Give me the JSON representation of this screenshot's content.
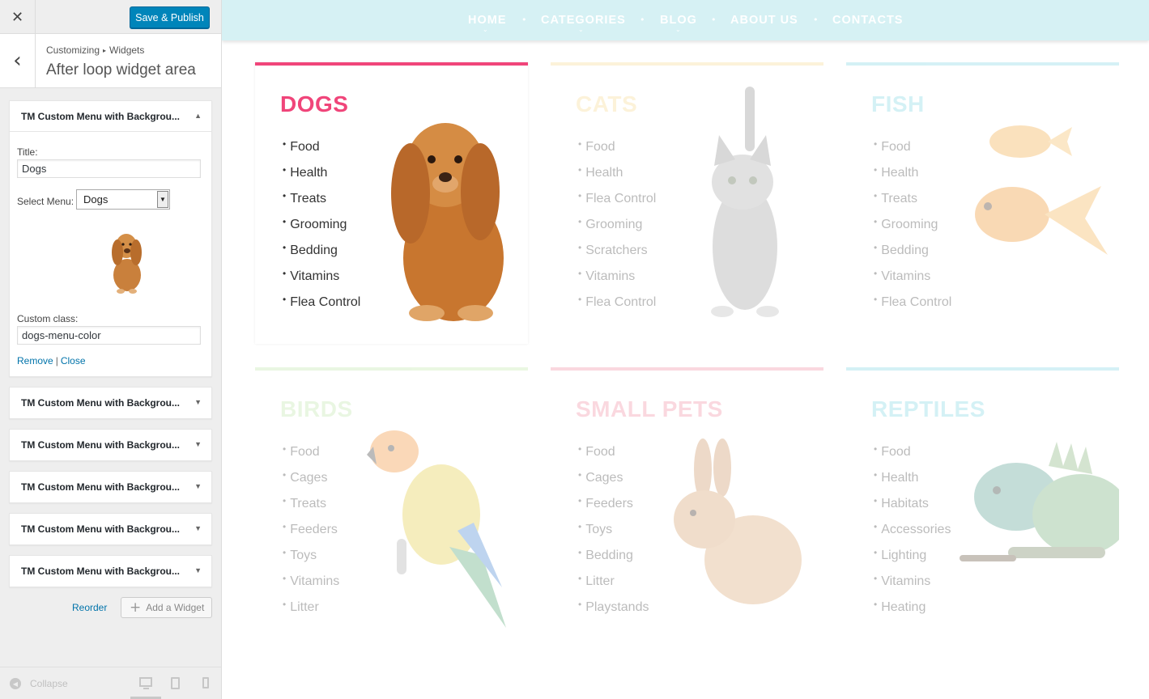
{
  "sidebar": {
    "close_glyph": "✕",
    "save_label": "Save & Publish",
    "back_glyph": "‹",
    "breadcrumb": {
      "root": "Customizing",
      "sep": "▸",
      "child": "Widgets"
    },
    "section_title": "After loop widget area",
    "active_widget": {
      "header": "TM Custom Menu with Backgrou...",
      "arrow": "▲",
      "title_label": "Title:",
      "title_value": "Dogs",
      "select_label": "Select Menu:",
      "select_value": "Dogs",
      "select_arrow": "▼",
      "class_label": "Custom class:",
      "class_value": "dogs-menu-color",
      "remove_label": "Remove",
      "link_sep": "|",
      "close_label": "Close"
    },
    "collapsed_widgets": [
      {
        "header": "TM Custom Menu with Backgrou...",
        "arrow": "▼"
      },
      {
        "header": "TM Custom Menu with Backgrou...",
        "arrow": "▼"
      },
      {
        "header": "TM Custom Menu with Backgrou...",
        "arrow": "▼"
      },
      {
        "header": "TM Custom Menu with Backgrou...",
        "arrow": "▼"
      },
      {
        "header": "TM Custom Menu with Backgrou...",
        "arrow": "▼"
      }
    ],
    "reorder_label": "Reorder",
    "add_widget_plus": "+",
    "add_widget_label": "Add a Widget",
    "collapse_glyph": "◀",
    "collapse_label": "Collapse"
  },
  "nav": {
    "items": [
      "HOME",
      "CATEGORIES",
      "BLOG",
      "ABOUT US",
      "CONTACTS"
    ],
    "dot": "•",
    "caret": "⌄",
    "bg_color": "#d6f1f4"
  },
  "cards": [
    {
      "title": "DOGS",
      "color": "#f0457a",
      "items": [
        "Food",
        "Health",
        "Treats",
        "Grooming",
        "Bedding",
        "Vitamins",
        "Flea Control"
      ]
    },
    {
      "title": "CATS",
      "color": "#f8d98d",
      "items": [
        "Food",
        "Health",
        "Flea Control",
        "Grooming",
        "Scratchers",
        "Vitamins",
        "Flea Control"
      ]
    },
    {
      "title": "FISH",
      "color": "#7fd6e3",
      "items": [
        "Food",
        "Health",
        "Treats",
        "Grooming",
        "Bedding",
        "Vitamins",
        "Flea Control"
      ]
    },
    {
      "title": "BIRDS",
      "color": "#bfe6a8",
      "items": [
        "Food",
        "Cages",
        "Treats",
        "Feeders",
        "Toys",
        "Vitamins",
        "Litter"
      ]
    },
    {
      "title": "SMALL PETS",
      "color": "#f08aa0",
      "items": [
        "Food",
        "Cages",
        "Feeders",
        "Toys",
        "Bedding",
        "Litter",
        "Playstands"
      ]
    },
    {
      "title": "REPTILES",
      "color": "#7fd6e3",
      "items": [
        "Food",
        "Health",
        "Habitats",
        "Accessories",
        "Lighting",
        "Vitamins",
        "Heating"
      ]
    }
  ]
}
